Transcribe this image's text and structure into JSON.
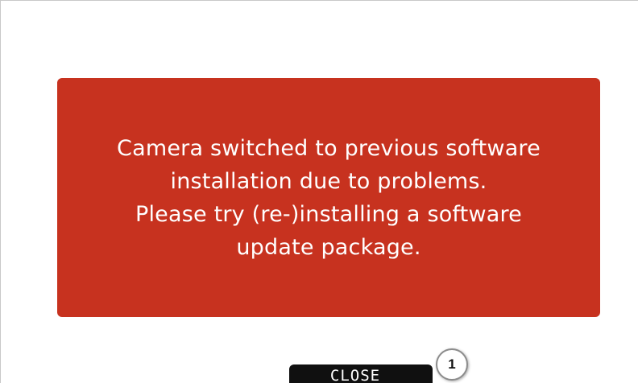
{
  "alert": {
    "lines": [
      "Camera switched to previous software",
      "installation due to problems.",
      "Please try (re-)installing a software",
      "update package."
    ]
  },
  "buttons": {
    "close_label": "CLOSE"
  },
  "callout": {
    "number": "1"
  },
  "colors": {
    "alert_background": "#c7321f",
    "button_background": "#101010",
    "page_background": "#ffffff"
  }
}
